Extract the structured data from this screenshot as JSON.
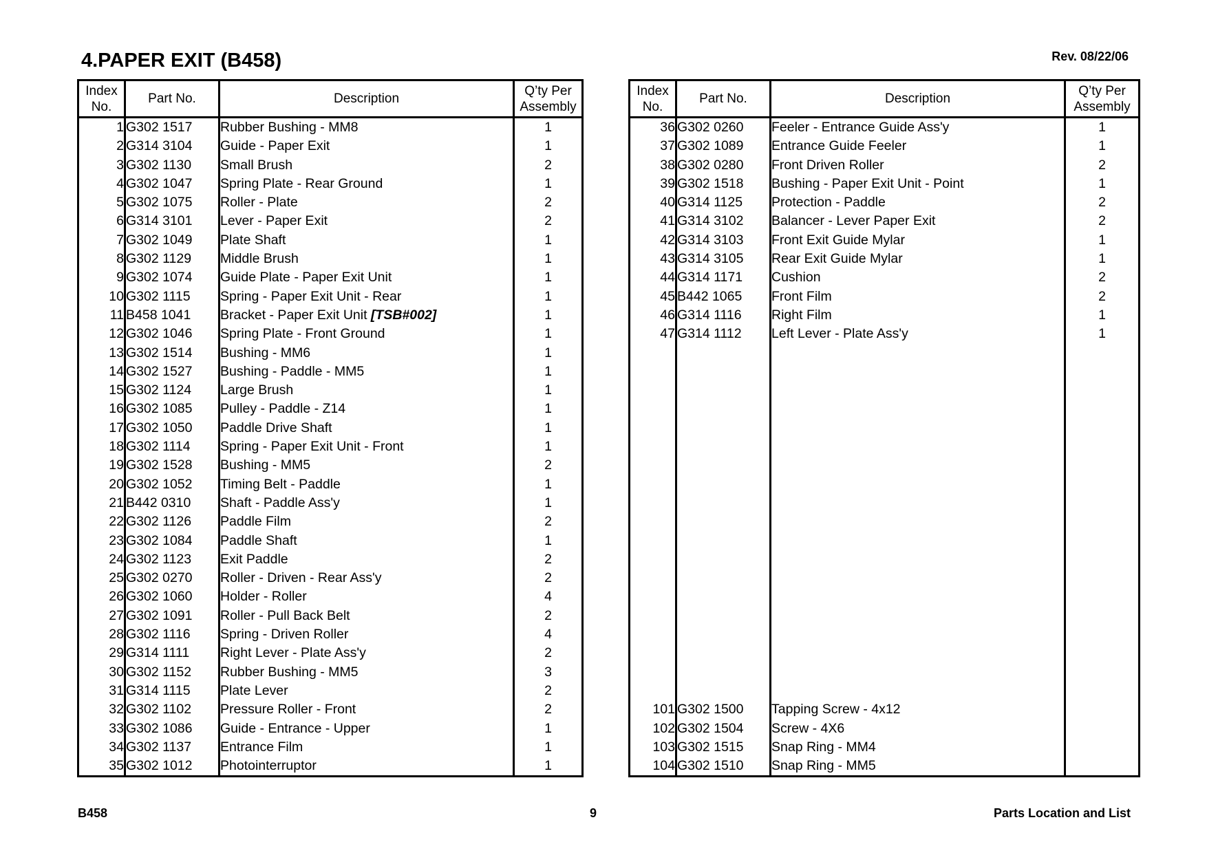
{
  "header": {
    "title": "4.PAPER EXIT (B458)",
    "revision": "Rev. 08/22/06"
  },
  "columns": {
    "index": "Index No.",
    "index_line1": "Index",
    "index_line2": "No.",
    "part_no": "Part No.",
    "description": "Description",
    "qty_line1": "Q’ty Per",
    "qty_line2": "Assembly"
  },
  "left_table": {
    "rows": [
      {
        "index": "1",
        "part_no": "G302 1517",
        "description": "Rubber Bushing - MM8",
        "qty": "1"
      },
      {
        "index": "2",
        "part_no": "G314 3104",
        "description": "Guide - Paper Exit",
        "qty": "1"
      },
      {
        "index": "3",
        "part_no": "G302 1130",
        "description": "Small Brush",
        "qty": "2"
      },
      {
        "index": "4",
        "part_no": "G302 1047",
        "description": "Spring Plate - Rear Ground",
        "qty": "1"
      },
      {
        "index": "5",
        "part_no": "G302 1075",
        "description": "Roller - Plate",
        "qty": "2"
      },
      {
        "index": "6",
        "part_no": "G314 3101",
        "description": "Lever - Paper Exit",
        "qty": "2"
      },
      {
        "index": "7",
        "part_no": "G302 1049",
        "description": "Plate Shaft",
        "qty": "1"
      },
      {
        "index": "8",
        "part_no": "G302 1129",
        "description": "Middle Brush",
        "qty": "1"
      },
      {
        "index": "9",
        "part_no": "G302 1074",
        "description": "Guide Plate - Paper Exit Unit",
        "qty": "1"
      },
      {
        "index": "10",
        "part_no": "G302 1115",
        "description": "Spring - Paper Exit Unit - Rear",
        "qty": "1"
      },
      {
        "index": "11",
        "part_no": "B458 1041",
        "description": "Bracket - Paper Exit Unit",
        "note": "[TSB#002]",
        "qty": "1"
      },
      {
        "index": "12",
        "part_no": "G302 1046",
        "description": "Spring Plate - Front Ground",
        "qty": "1"
      },
      {
        "index": "13",
        "part_no": "G302 1514",
        "description": "Bushing - MM6",
        "qty": "1"
      },
      {
        "index": "14",
        "part_no": "G302 1527",
        "description": "Bushing - Paddle - MM5",
        "qty": "1"
      },
      {
        "index": "15",
        "part_no": "G302 1124",
        "description": "Large Brush",
        "qty": "1"
      },
      {
        "index": "16",
        "part_no": "G302 1085",
        "description": "Pulley - Paddle - Z14",
        "qty": "1"
      },
      {
        "index": "17",
        "part_no": "G302 1050",
        "description": "Paddle Drive Shaft",
        "qty": "1"
      },
      {
        "index": "18",
        "part_no": "G302 1114",
        "description": "Spring - Paper Exit Unit - Front",
        "qty": "1"
      },
      {
        "index": "19",
        "part_no": "G302 1528",
        "description": "Bushing - MM5",
        "qty": "2"
      },
      {
        "index": "20",
        "part_no": "G302 1052",
        "description": "Timing Belt - Paddle",
        "qty": "1"
      },
      {
        "index": "21",
        "part_no": "B442 0310",
        "description": "Shaft - Paddle Ass'y",
        "qty": "1"
      },
      {
        "index": "22",
        "part_no": "G302 1126",
        "description": "Paddle Film",
        "qty": "2"
      },
      {
        "index": "23",
        "part_no": "G302 1084",
        "description": "Paddle Shaft",
        "qty": "1"
      },
      {
        "index": "24",
        "part_no": "G302 1123",
        "description": "Exit Paddle",
        "qty": "2"
      },
      {
        "index": "25",
        "part_no": "G302 0270",
        "description": "Roller - Driven - Rear Ass'y",
        "qty": "2"
      },
      {
        "index": "26",
        "part_no": "G302 1060",
        "description": "Holder - Roller",
        "qty": "4"
      },
      {
        "index": "27",
        "part_no": "G302 1091",
        "description": "Roller - Pull Back Belt",
        "qty": "2"
      },
      {
        "index": "28",
        "part_no": "G302 1116",
        "description": "Spring - Driven Roller",
        "qty": "4"
      },
      {
        "index": "29",
        "part_no": "G314 1111",
        "description": "Right Lever - Plate Ass'y",
        "qty": "2"
      },
      {
        "index": "30",
        "part_no": "G302 1152",
        "description": "Rubber Bushing - MM5",
        "qty": "3"
      },
      {
        "index": "31",
        "part_no": "G314 1115",
        "description": "Plate Lever",
        "qty": "2"
      },
      {
        "index": "32",
        "part_no": "G302 1102",
        "description": "Pressure Roller - Front",
        "qty": "2"
      },
      {
        "index": "33",
        "part_no": "G302 1086",
        "description": "Guide - Entrance - Upper",
        "qty": "1"
      },
      {
        "index": "34",
        "part_no": "G302 1137",
        "description": "Entrance Film",
        "qty": "1"
      },
      {
        "index": "35",
        "part_no": "G302 1012",
        "description": "Photointerruptor",
        "qty": "1"
      }
    ]
  },
  "right_table": {
    "rows": [
      {
        "index": "36",
        "part_no": "G302 0260",
        "description": "Feeler - Entrance Guide Ass'y",
        "qty": "1"
      },
      {
        "index": "37",
        "part_no": "G302 1089",
        "description": "Entrance Guide Feeler",
        "qty": "1"
      },
      {
        "index": "38",
        "part_no": "G302 0280",
        "description": "Front Driven Roller",
        "qty": "2"
      },
      {
        "index": "39",
        "part_no": "G302 1518",
        "description": "Bushing - Paper Exit Unit - Point",
        "qty": "1"
      },
      {
        "index": "40",
        "part_no": "G314 1125",
        "description": "Protection - Paddle",
        "qty": "2"
      },
      {
        "index": "41",
        "part_no": "G314 3102",
        "description": "Balancer - Lever Paper Exit",
        "qty": "2"
      },
      {
        "index": "42",
        "part_no": "G314 3103",
        "description": "Front Exit Guide Mylar",
        "qty": "1"
      },
      {
        "index": "43",
        "part_no": "G314 3105",
        "description": "Rear Exit Guide Mylar",
        "qty": "1"
      },
      {
        "index": "44",
        "part_no": "G314 1171",
        "description": "Cushion",
        "qty": "2"
      },
      {
        "index": "45",
        "part_no": "B442 1065",
        "description": "Front Film",
        "qty": "2"
      },
      {
        "index": "46",
        "part_no": "G314 1116",
        "description": "Right Film",
        "qty": "1"
      },
      {
        "index": "47",
        "part_no": "G314 1112",
        "description": "Left Lever - Plate Ass'y",
        "qty": "1"
      }
    ],
    "screw_rows": [
      {
        "index": "101",
        "part_no": "G302 1500",
        "description": "Tapping Screw - 4x12",
        "qty": ""
      },
      {
        "index": "102",
        "part_no": "G302 1504",
        "description": "Screw - 4X6",
        "qty": ""
      },
      {
        "index": "103",
        "part_no": "G302 1515",
        "description": "Snap Ring - MM4",
        "qty": ""
      },
      {
        "index": "104",
        "part_no": "G302 1510",
        "description": "Snap Ring - MM5",
        "qty": ""
      }
    ]
  },
  "footer": {
    "model": "B458",
    "page_number": "9",
    "section": "Parts Location and List"
  }
}
